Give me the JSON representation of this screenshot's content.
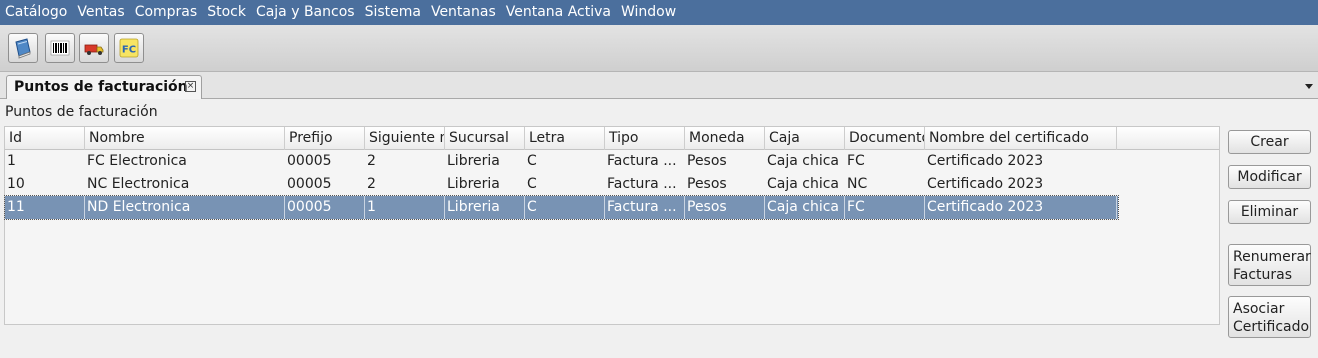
{
  "menu": [
    "Catálogo",
    "Ventas",
    "Compras",
    "Stock",
    "Caja y Bancos",
    "Sistema",
    "Ventanas",
    "Ventana Activa",
    "Window"
  ],
  "toolbar": {
    "buttons": [
      {
        "icon": "book-icon"
      },
      {
        "icon": "barcode-icon"
      },
      {
        "icon": "delivery-truck-icon"
      },
      {
        "icon": "fc-invoice-icon",
        "text": "FC"
      }
    ]
  },
  "tab": {
    "title": "Puntos de facturación"
  },
  "section_title": "Puntos de facturación",
  "table": {
    "columns": [
      "Id",
      "Nombre",
      "Prefijo",
      "Siguiente n",
      "Sucursal",
      "Letra",
      "Tipo",
      "Moneda",
      "Caja",
      "Documento",
      "Nombre del certificado"
    ],
    "rows": [
      [
        "1",
        "FC Electronica",
        "00005",
        "2",
        "Libreria",
        "C",
        "Factura ...",
        "Pesos",
        "Caja chica",
        "FC",
        "Certificado 2023"
      ],
      [
        "10",
        "NC Electronica",
        "00005",
        "2",
        "Libreria",
        "C",
        "Factura ...",
        "Pesos",
        "Caja chica",
        "NC",
        "Certificado 2023"
      ],
      [
        "11",
        "ND Electronica",
        "00005",
        "1",
        "Libreria",
        "C",
        "Factura ...",
        "Pesos",
        "Caja chica",
        "FC",
        "Certificado 2023"
      ]
    ],
    "selected_row": 2
  },
  "actions": {
    "crear": "Crear",
    "modificar": "Modificar",
    "eliminar": "Eliminar",
    "renumerar_l1": "Renumerar",
    "renumerar_l2": "Facturas",
    "asociar_l1": "Asociar",
    "asociar_l2": "Certificado"
  },
  "colors": {
    "menubar": "#4b6f9d",
    "selection": "#7893b4"
  }
}
